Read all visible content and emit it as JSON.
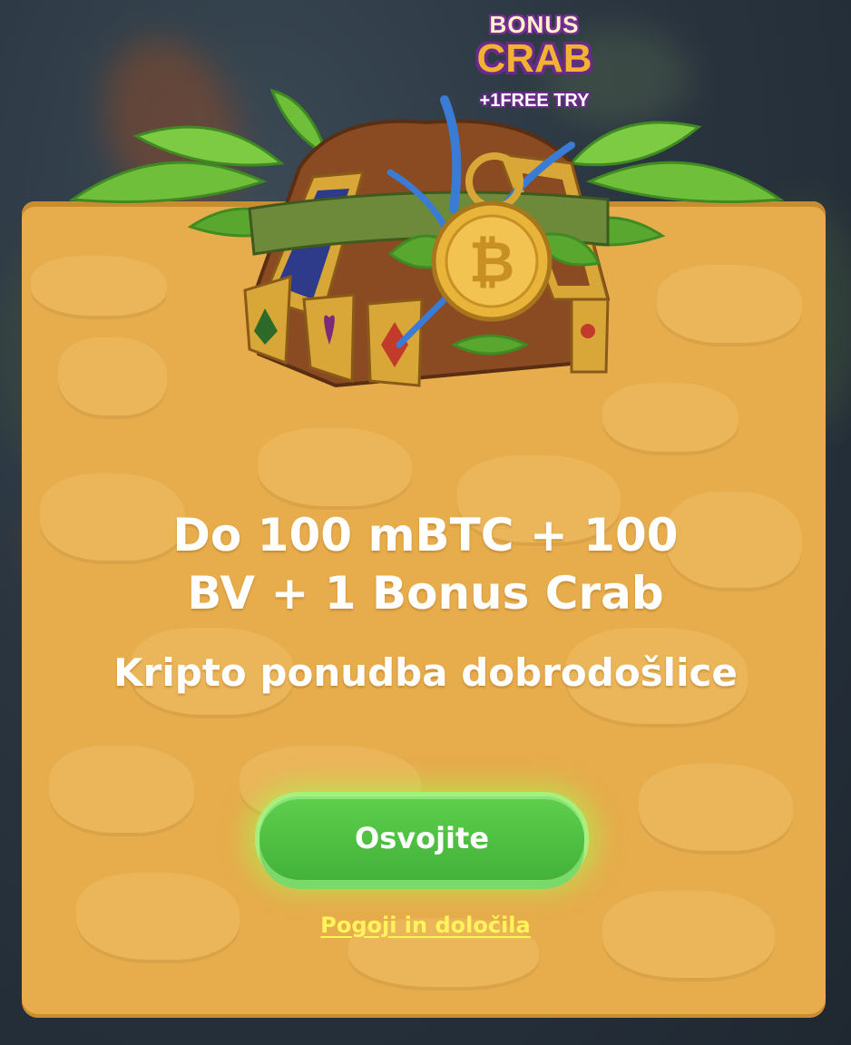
{
  "logo": {
    "line1": "BONUS",
    "line2": "CRAB",
    "line3": "+1FREE TRY"
  },
  "offer": {
    "headline_line1": "Do 100 mBTC + 100",
    "headline_line2": "BV + 1 Bonus Crab",
    "subtitle": "Kripto ponudba dobrodošlice"
  },
  "cta": {
    "label": "Osvojite"
  },
  "terms": {
    "label": "Pogoji in določila"
  },
  "colors": {
    "panel": "#e7ac4c",
    "button_green": "#4cbd3f",
    "terms_link": "#fff45a",
    "background": "#2a3540"
  },
  "icons": {
    "chest": "treasure-chest-icon",
    "coin": "bitcoin-coin-icon"
  }
}
